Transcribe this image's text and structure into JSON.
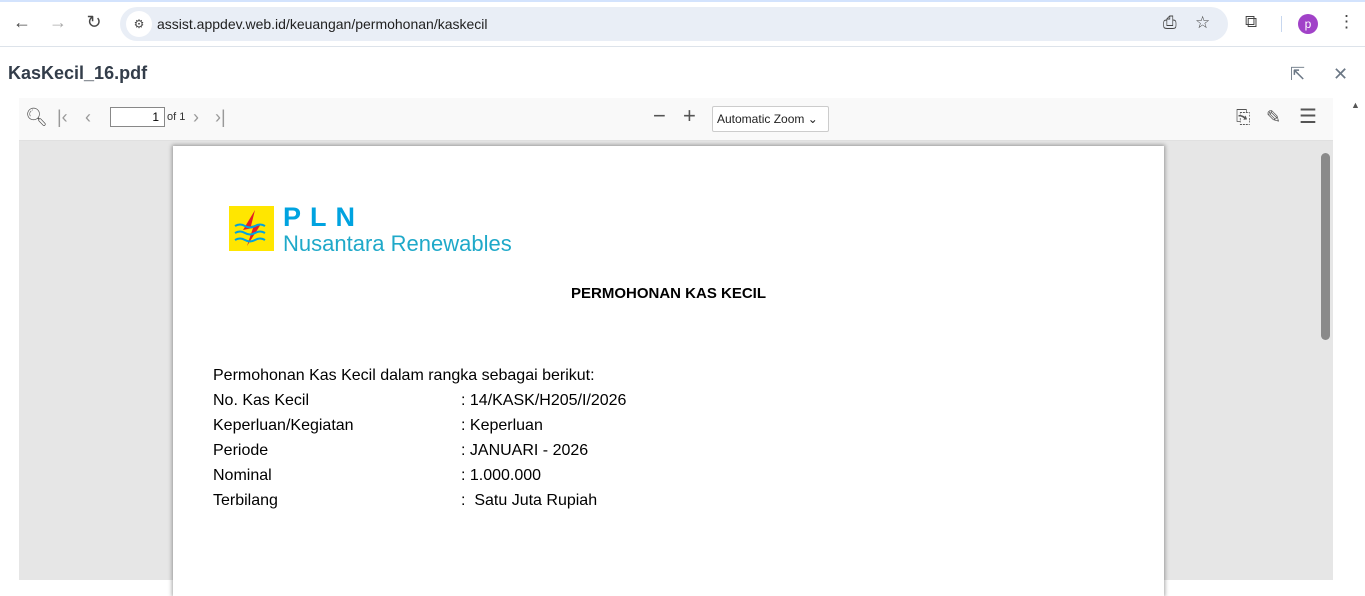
{
  "browser": {
    "url": "assist.appdev.web.id/keuangan/permohonan/kaskecil",
    "avatar_letter": "p"
  },
  "modal": {
    "title": "KasKecil_16.pdf"
  },
  "pdf_toolbar": {
    "page": "1",
    "of_pages": "of 1",
    "zoom": "Automatic Zoom"
  },
  "document": {
    "logo_title": "PLN",
    "logo_subtitle": "Nusantara Renewables",
    "title": "PERMOHONAN KAS KECIL",
    "intro": "Permohonan Kas Kecil dalam rangka sebagai berikut:",
    "rows": [
      {
        "label": "No. Kas Kecil",
        "value": ": 14/KASK/H205/I/2026"
      },
      {
        "label": "Keperluan/Kegiatan",
        "value": ": Keperluan"
      },
      {
        "label": "Periode",
        "value": ": JANUARI - 2026"
      },
      {
        "label": "Nominal",
        "value": ": 1.000.000"
      },
      {
        "label": "Terbilang",
        "value": ":  Satu Juta Rupiah"
      }
    ]
  }
}
